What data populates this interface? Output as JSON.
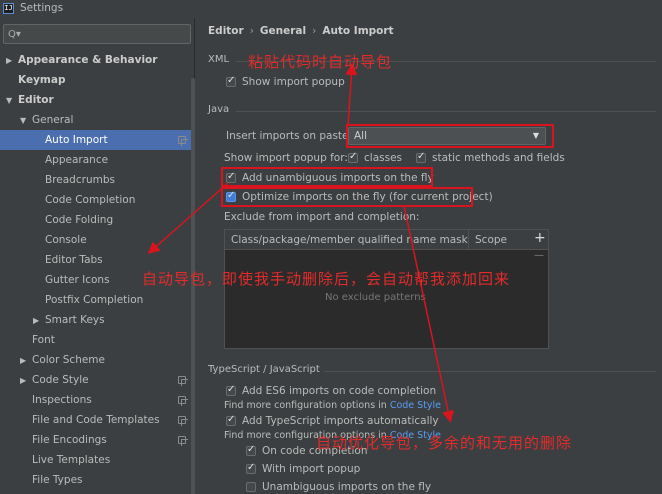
{
  "window": {
    "title": "Settings",
    "app_icon": "intellij-icon"
  },
  "search": {
    "value": "",
    "placeholder": ""
  },
  "sidebar": {
    "items": [
      {
        "label": "Appearance & Behavior",
        "level": 0,
        "arrow": "▶",
        "bold": true
      },
      {
        "label": "Keymap",
        "level": 0,
        "arrow": "",
        "bold": true
      },
      {
        "label": "Editor",
        "level": 0,
        "arrow": "▼",
        "bold": true
      },
      {
        "label": "General",
        "level": 1,
        "arrow": "▼"
      },
      {
        "label": "Auto Import",
        "level": 2,
        "selected": true,
        "copy": true
      },
      {
        "label": "Appearance",
        "level": 2
      },
      {
        "label": "Breadcrumbs",
        "level": 2
      },
      {
        "label": "Code Completion",
        "level": 2
      },
      {
        "label": "Code Folding",
        "level": 2
      },
      {
        "label": "Console",
        "level": 2
      },
      {
        "label": "Editor Tabs",
        "level": 2
      },
      {
        "label": "Gutter Icons",
        "level": 2
      },
      {
        "label": "Postfix Completion",
        "level": 2
      },
      {
        "label": "Smart Keys",
        "level": 2,
        "arrow": "▶"
      },
      {
        "label": "Font",
        "level": 1
      },
      {
        "label": "Color Scheme",
        "level": 1,
        "arrow": "▶"
      },
      {
        "label": "Code Style",
        "level": 1,
        "arrow": "▶",
        "copy": true
      },
      {
        "label": "Inspections",
        "level": 1,
        "copy": true
      },
      {
        "label": "File and Code Templates",
        "level": 1,
        "copy": true
      },
      {
        "label": "File Encodings",
        "level": 1,
        "copy": true
      },
      {
        "label": "Live Templates",
        "level": 1
      },
      {
        "label": "File Types",
        "level": 1
      }
    ]
  },
  "breadcrumb": [
    "Editor",
    "General",
    "Auto Import"
  ],
  "breadcrumb_separator": "›",
  "xml": {
    "section_label": "XML",
    "show_import_popup": {
      "label": "Show import popup",
      "checked": true
    }
  },
  "java": {
    "section_label": "Java",
    "insert_imports_label": "Insert imports on paste:",
    "insert_imports_value": "All",
    "show_popup_for_label": "Show import popup for:",
    "classes_label": "classes",
    "static_label": "static methods and fields",
    "add_unambiguous_label": "Add unambiguous imports on the fly",
    "optimize_label": "Optimize imports on the fly (for current project)",
    "exclude_label": "Exclude from import and completion:",
    "table_col1": "Class/package/member qualified name mask",
    "table_col2": "Scope",
    "table_empty": "No exclude patterns",
    "add_btn": "+",
    "remove_btn": "—"
  },
  "typescript": {
    "section_label": "TypeScript / JavaScript",
    "add_es6_label": "Add ES6 imports on code completion",
    "find_more_1": "Find more configuration options in",
    "code_style_link_1": "Code Style",
    "add_ts_label": "Add TypeScript imports automatically",
    "find_more_2": "Find more configuration options in",
    "code_style_link_2": "Code Style",
    "on_code_completion": "On code completion",
    "with_import_popup": "With import popup",
    "unambiguous_fly": "Unambiguous imports on the fly"
  },
  "annotations": {
    "note1": "粘贴代码时自动导包",
    "note2": "自动导包，即使我手动删除后，会自动帮我添加回来",
    "note3": "自动优化导包，多余的和无用的删除",
    "color": "#e32b2b"
  },
  "colors": {
    "selection": "#4b6eaf",
    "link": "#589df6",
    "background": "#3c3f41"
  }
}
